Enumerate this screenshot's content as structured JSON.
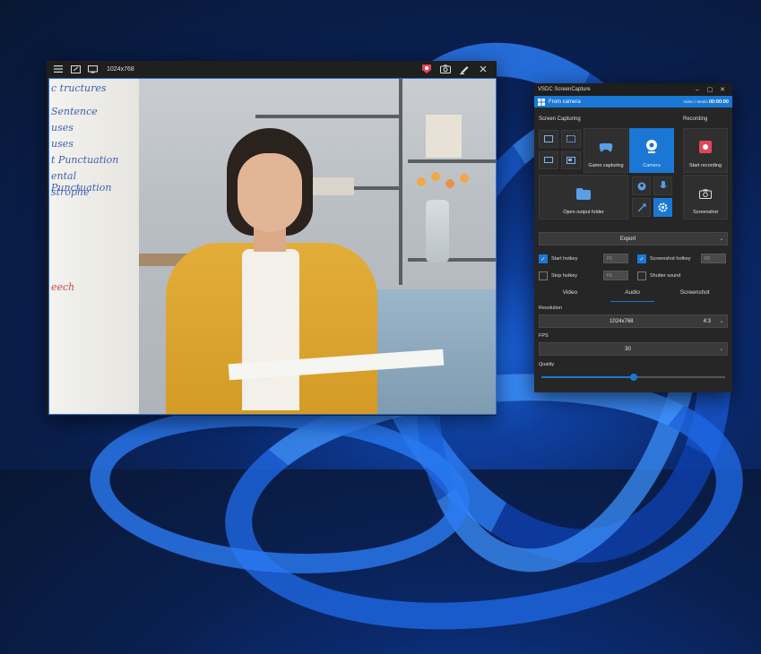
{
  "camera_window": {
    "resolution_label": "1024x768",
    "icons": [
      "menu-icon",
      "region-icon",
      "monitor-icon",
      "record-shield-icon",
      "snapshot-icon",
      "draw-icon",
      "close-icon"
    ]
  },
  "whiteboard_lines": [
    "c tructures",
    "Sentence",
    "uses",
    "uses",
    "t Punctuation",
    "ental Punctuation",
    "strophe",
    "eech"
  ],
  "panel": {
    "title": "VSDC ScreenCapture",
    "source": "From camera",
    "timer_prefix": "Video / Media",
    "timer": "00:00:00",
    "screen_capturing_label": "Screen Capturing",
    "recording_label": "Recording",
    "game_capturing": "Game capturing",
    "camera": "Camera",
    "start_recording": "Start recording",
    "open_output_folder": "Open output folder",
    "screenshot_tile": "Screenshot",
    "export": "Export",
    "start_hotkey": "Start hotkey",
    "start_hotkey_value": "F5",
    "screenshot_hotkey": "Screenshot hotkey",
    "screenshot_hotkey_value": "F8",
    "stop_hotkey": "Stop hotkey",
    "stop_hotkey_value": "F6",
    "shutter_sound": "Shutter sound",
    "tabs": [
      "Video",
      "Audio",
      "Screenshot"
    ],
    "resolution_label": "Resolution",
    "resolution_value": "1024x768",
    "aspect_value": "4:3",
    "fps_label": "FPS",
    "fps_value": "30",
    "quality_label": "Quality",
    "quality_level": 0.5
  },
  "colors": {
    "accent": "#1a78d4",
    "panel_bg": "#262626",
    "record_red": "#e0455a"
  }
}
